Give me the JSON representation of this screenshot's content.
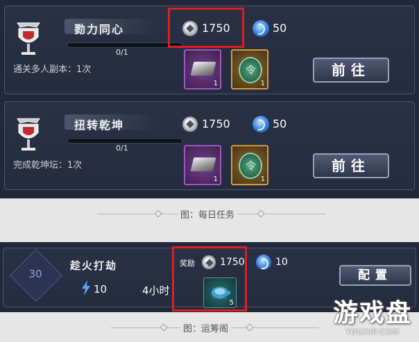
{
  "tasks": [
    {
      "title": "勠力同心",
      "progress": "0/1",
      "progress_fraction": 0,
      "description": "通关多人副本：1次",
      "coins": "1750",
      "gems": "50",
      "item1_qty": "1",
      "item2_qty": "1",
      "button": "前往"
    },
    {
      "title": "扭转乾坤",
      "progress": "0/1",
      "progress_fraction": 0,
      "description": "完成乾坤坛：1次",
      "coins": "1750",
      "gems": "50",
      "item1_qty": "1",
      "item2_qty": "1",
      "button": "前往"
    }
  ],
  "caption1": "图：每日任务",
  "yunchou": {
    "level": "30",
    "title": "趁火打劫",
    "energy": "10",
    "duration": "4小时",
    "reward_label": "奖励",
    "coins": "1750",
    "gems": "10",
    "item_qty": "5",
    "button": "配置"
  },
  "caption2": "图：运筹阁",
  "watermark": {
    "big": "游戏盘",
    "small": "YOUXIP.COM"
  },
  "colors": {
    "highlight": "#e01e1e",
    "panel": "#21283c"
  }
}
